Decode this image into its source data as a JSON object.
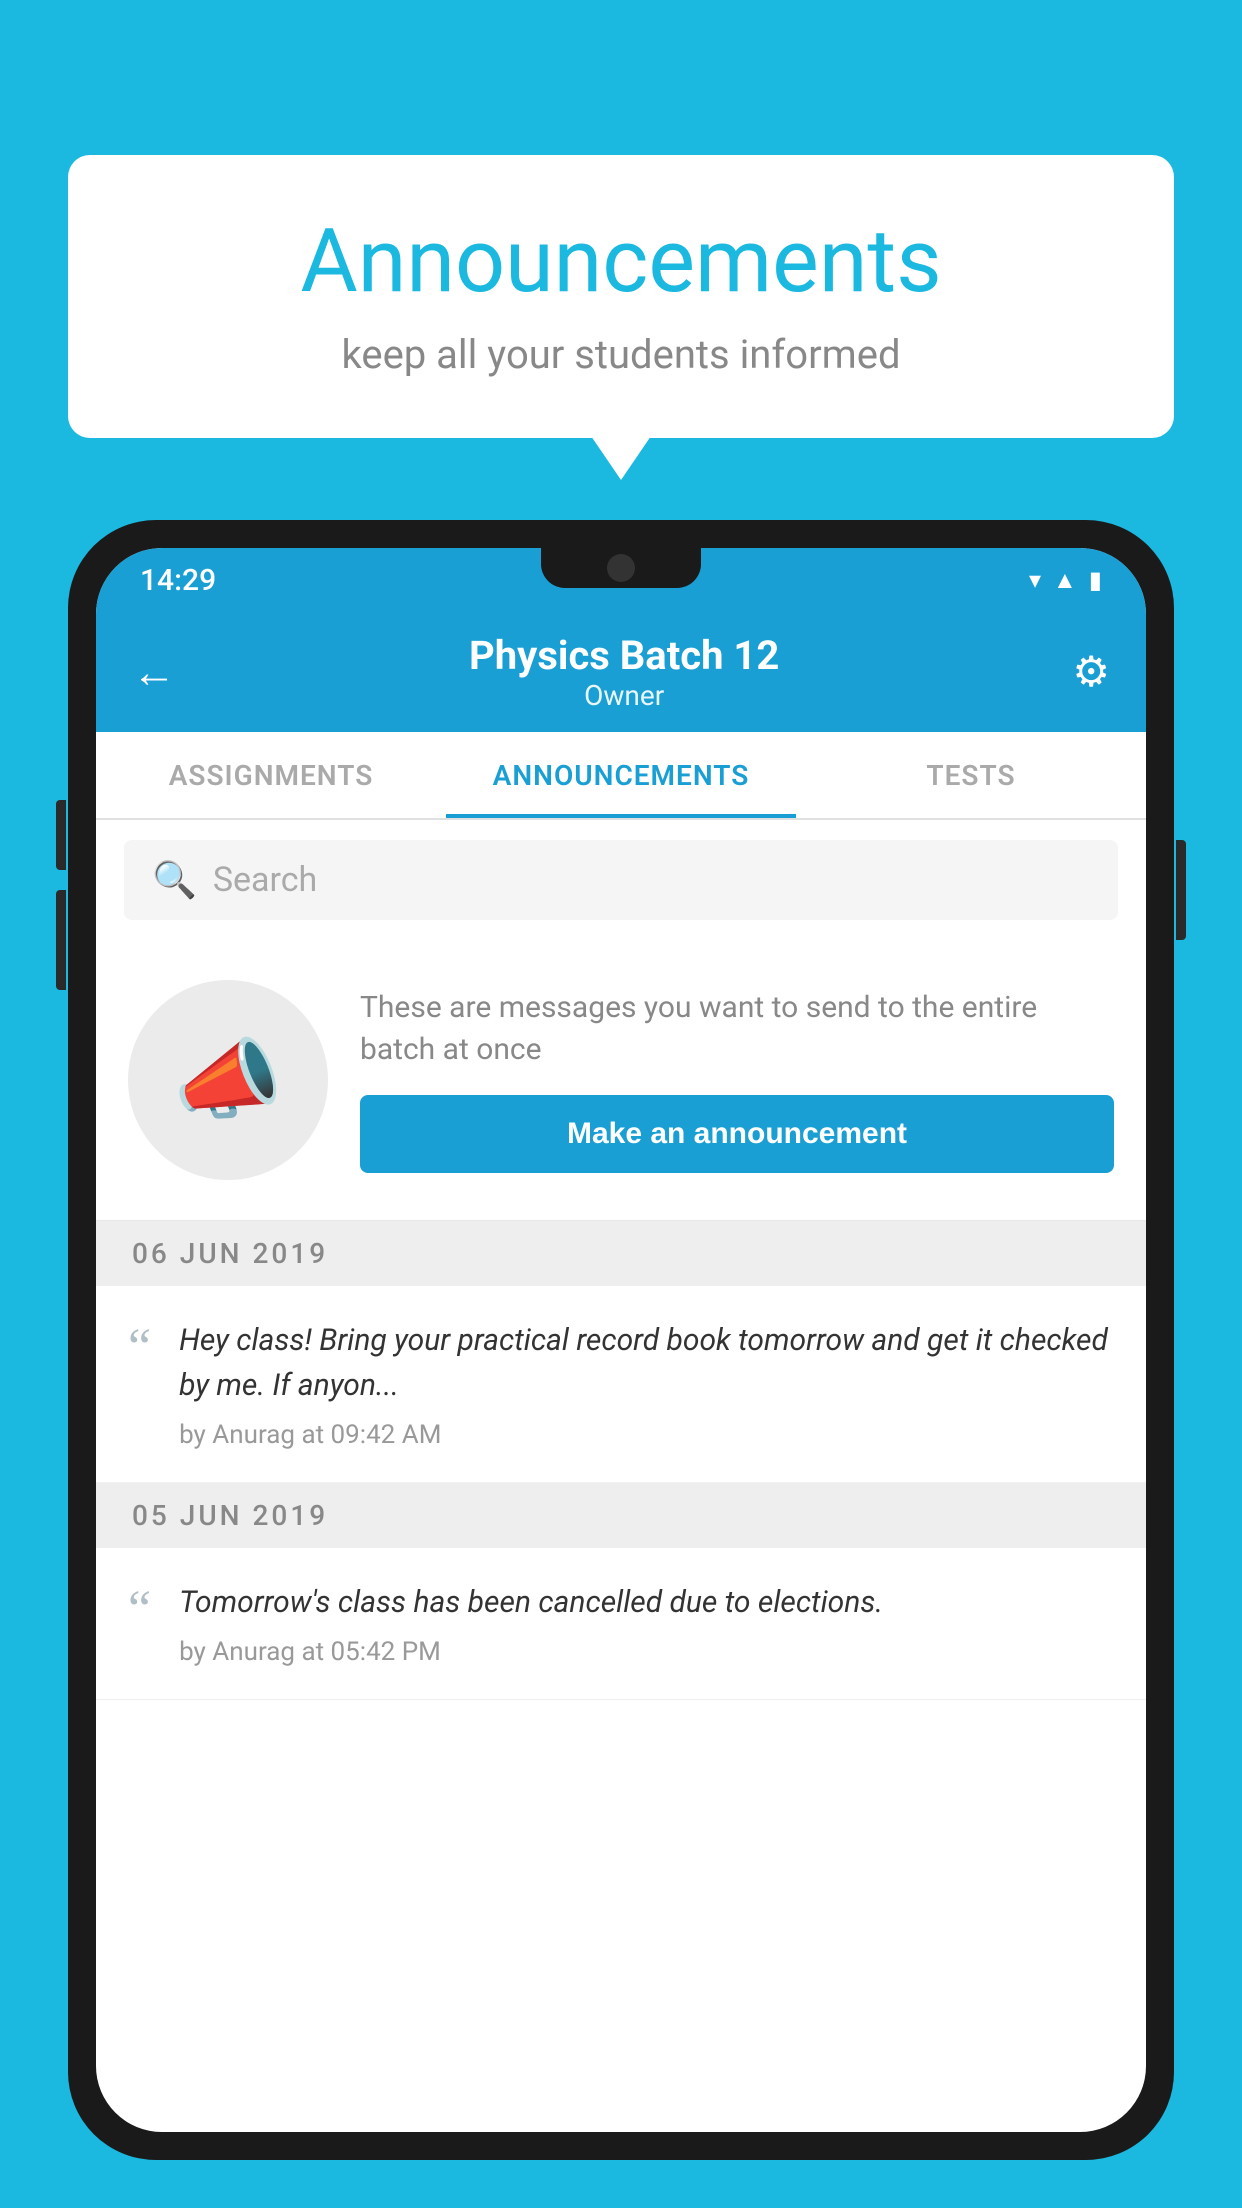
{
  "background_color": "#1BB8E0",
  "speech_bubble": {
    "title": "Announcements",
    "subtitle": "keep all your students informed"
  },
  "phone": {
    "status_bar": {
      "time": "14:29",
      "icons": [
        "wifi",
        "signal",
        "battery"
      ]
    },
    "app_bar": {
      "title": "Physics Batch 12",
      "subtitle": "Owner",
      "back_label": "←",
      "settings_label": "⚙"
    },
    "tabs": [
      {
        "label": "ASSIGNMENTS",
        "active": false
      },
      {
        "label": "ANNOUNCEMENTS",
        "active": true
      },
      {
        "label": "TESTS",
        "active": false
      }
    ],
    "search": {
      "placeholder": "Search"
    },
    "promo": {
      "description": "These are messages you want to send to the entire batch at once",
      "button_label": "Make an announcement"
    },
    "messages": [
      {
        "date": "06  JUN  2019",
        "text": "Hey class! Bring your practical record book tomorrow and get it checked by me. If anyon...",
        "meta": "by Anurag at 09:42 AM"
      },
      {
        "date": "05  JUN  2019",
        "text": "Tomorrow's class has been cancelled due to elections.",
        "meta": "by Anurag at 05:42 PM"
      }
    ]
  }
}
